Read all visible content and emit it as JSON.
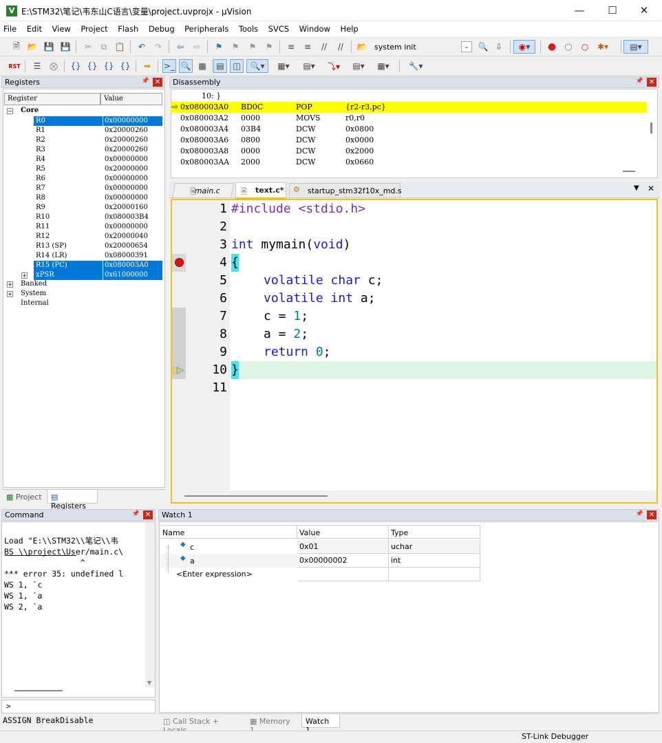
{
  "window": {
    "title": "E:\\STM32\\笔记\\韦东山C语言\\变量\\project.uvprojx - µVision",
    "app_icon": "V"
  },
  "menu": [
    "File",
    "Edit",
    "View",
    "Project",
    "Flash",
    "Debug",
    "Peripherals",
    "Tools",
    "SVCS",
    "Window",
    "Help"
  ],
  "toolbar": {
    "target_label": "system init"
  },
  "registers": {
    "title": "Registers",
    "col_register": "Register",
    "col_value": "Value",
    "core_label": "Core",
    "rows": [
      {
        "name": "R0",
        "value": "0x00000000"
      },
      {
        "name": "R1",
        "value": "0x20000260"
      },
      {
        "name": "R2",
        "value": "0x20000260"
      },
      {
        "name": "R3",
        "value": "0x20000260"
      },
      {
        "name": "R4",
        "value": "0x00000000"
      },
      {
        "name": "R5",
        "value": "0x20000000"
      },
      {
        "name": "R6",
        "value": "0x00000000"
      },
      {
        "name": "R7",
        "value": "0x00000000"
      },
      {
        "name": "R8",
        "value": "0x00000000"
      },
      {
        "name": "R9",
        "value": "0x20000160"
      },
      {
        "name": "R10",
        "value": "0x080003B4"
      },
      {
        "name": "R11",
        "value": "0x00000000"
      },
      {
        "name": "R12",
        "value": "0x20000040"
      },
      {
        "name": "R13 (SP)",
        "value": "0x20000654"
      },
      {
        "name": "R14 (LR)",
        "value": "0x08000391"
      },
      {
        "name": "R15 (PC)",
        "value": "0x080003A0"
      },
      {
        "name": "xPSR",
        "value": "0x61000000"
      }
    ],
    "groups": [
      "Banked",
      "System",
      "Internal"
    ],
    "tabs": [
      "Project",
      "Registers"
    ]
  },
  "disassembly": {
    "title": "Disassembly",
    "header_line": "10: }",
    "rows": [
      {
        "addr": "0x080003A0",
        "hex": "BD0C",
        "op": "POP",
        "args": "{r2-r3,pc}"
      },
      {
        "addr": "0x080003A2",
        "hex": "0000",
        "op": "MOVS",
        "args": "r0,r0"
      },
      {
        "addr": "0x080003A4",
        "hex": "03B4",
        "op": "DCW",
        "args": "0x0800"
      },
      {
        "addr": "0x080003A6",
        "hex": "0800",
        "op": "DCW",
        "args": "0x0000"
      },
      {
        "addr": "0x080003A8",
        "hex": "0000",
        "op": "DCW",
        "args": "0x2000"
      },
      {
        "addr": "0x080003AA",
        "hex": "2000",
        "op": "DCW",
        "args": "0x0660"
      }
    ]
  },
  "editor": {
    "tabs": [
      "main.c",
      "text.c*",
      "startup_stm32f10x_md.s"
    ],
    "lines": [
      "1",
      "2",
      "3",
      "4",
      "5",
      "6",
      "7",
      "8",
      "9",
      "10",
      "11"
    ],
    "code": {
      "l1_pp": "#include",
      "l1_hdr": " <stdio.h>",
      "l3_kw1": "int",
      "l3_name": " mymain(",
      "l3_kw2": "void",
      "l3_end": ")",
      "l4": "{",
      "l5_kw1": "volatile",
      "l5_kw2": "char",
      "l5_end": " c;",
      "l6_kw1": "volatile",
      "l6_kw2": "int",
      "l6_end": " a;",
      "l7_a": "c = ",
      "l7_n": "1",
      "l7_e": ";",
      "l8_a": "a = ",
      "l8_n": "2",
      "l8_e": ";",
      "l9_kw": "return",
      "l9_n": "0",
      "l9_e": ";",
      "l10": "}"
    }
  },
  "command": {
    "title": "Command",
    "lines": [
      "Load \"E:\\\\STM32\\\\笔记\\\\韦",
      "BS \\\\project\\User/main.c\\",
      "                ^",
      "*** error 35: undefined l",
      "WS 1, `c",
      "WS 1, `a",
      "WS 2, `a"
    ],
    "prompt": ">",
    "status": "ASSIGN BreakDisable"
  },
  "watch": {
    "title": "Watch 1",
    "col_name": "Name",
    "col_value": "Value",
    "col_type": "Type",
    "rows": [
      {
        "name": "c",
        "value": "0x01",
        "type": "uchar"
      },
      {
        "name": "a",
        "value": "0x00000002",
        "type": "int"
      }
    ],
    "enter_expression": "<Enter expression>",
    "tabs": [
      "Call Stack + Locals",
      "Memory 1",
      "Watch 1"
    ]
  },
  "statusbar": {
    "debugger": "ST-Link Debugger"
  }
}
